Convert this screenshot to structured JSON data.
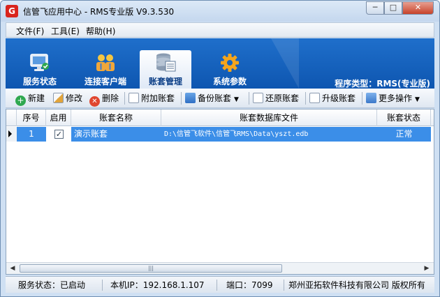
{
  "window": {
    "title": "信管飞应用中心 - RMS专业版 V9.3.530",
    "app_icon_glyph": "G",
    "minimize_glyph": "─",
    "maximize_glyph": "□",
    "close_glyph": "✕"
  },
  "menu": [
    {
      "label": "文件(F)"
    },
    {
      "label": "工具(E)"
    },
    {
      "label": "帮助(H)"
    }
  ],
  "nav": {
    "tabs": [
      {
        "label": "服务状态",
        "icon": "monitor-icon",
        "active": false
      },
      {
        "label": "连接客户端",
        "icon": "users-icon",
        "active": false
      },
      {
        "label": "账套管理",
        "icon": "database-icon",
        "active": true
      },
      {
        "label": "系统参数",
        "icon": "gear-icon",
        "active": false
      }
    ],
    "program_type": "程序类型：RMS(专业版)"
  },
  "toolbar": {
    "new": "新建",
    "edit": "修改",
    "delete": "删除",
    "attach": "附加账套",
    "backup": "备份账套",
    "restore": "还原账套",
    "upgrade": "升级账套",
    "more": "更多操作",
    "dropdown_glyph": "▼"
  },
  "grid": {
    "columns": [
      "序号",
      "启用",
      "账套名称",
      "账套数据库文件",
      "账套状态"
    ],
    "rows": [
      {
        "seq": "1",
        "enabled": true,
        "check_glyph": "✓",
        "name": "演示账套",
        "file": "D:\\信管飞软件\\信管飞RMS\\Data\\yszt.edb",
        "status": "正常"
      }
    ],
    "scroll_left_glyph": "◀",
    "scroll_right_glyph": "▶",
    "scroll_grip": "|||"
  },
  "status": {
    "service": "服务状态：已启动",
    "ip": "本机IP：192.168.1.107",
    "port": "端口：7099",
    "copyright": "郑州亚拓软件科技有限公司  版权所有"
  },
  "colors": {
    "nav_band": "#1565c0",
    "selection": "#3b8ee8",
    "app_icon": "#d9251d"
  }
}
